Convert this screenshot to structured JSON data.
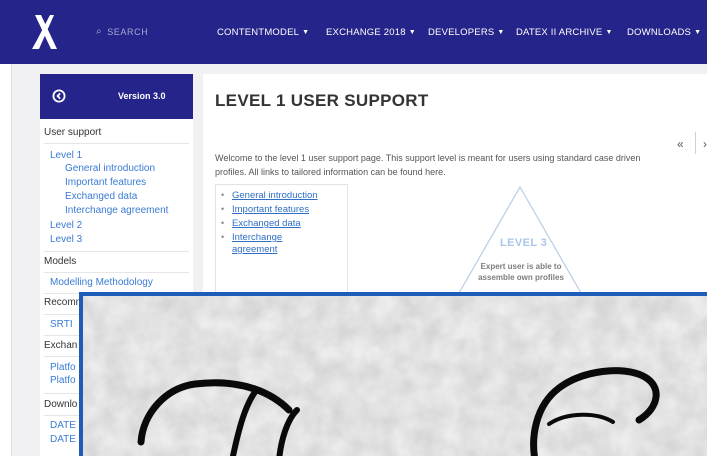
{
  "nav": {
    "logo_icon": "x-logo-icon",
    "search_label": "SEARCH",
    "items": [
      {
        "label": "CONTENTMODEL"
      },
      {
        "label": "EXCHANGE 2018"
      },
      {
        "label": "DEVELOPERS"
      },
      {
        "label": "DATEX II ARCHIVE"
      },
      {
        "label": "DOWNLOADS"
      }
    ],
    "brand_color": "#24248a"
  },
  "sidebar": {
    "version": "Version 3.0",
    "back_icon": "back-arrow-icon",
    "sections": [
      {
        "title": "User support",
        "items": [
          "Level 1",
          "General introduction",
          "Important features",
          "Exchanged data",
          "Interchange agreement",
          "Level 2",
          "Level 3"
        ]
      },
      {
        "title": "Models",
        "items": [
          "Modelling Methodology"
        ]
      },
      {
        "title": "Recomm",
        "items": [
          "SRTI"
        ]
      },
      {
        "title": "Exchan",
        "items": [
          "Platfo",
          "Platfo"
        ]
      },
      {
        "title": "Downlo",
        "items": [
          "DATE",
          "DATE"
        ]
      }
    ],
    "link_color": "#3a7bd5"
  },
  "main": {
    "title": "LEVEL 1 USER SUPPORT",
    "pager_prev": "«",
    "pager_next": "›",
    "intro_line1": "Welcome to the level 1 user support page. This support level is meant for users using standard case driven",
    "intro_line2": "profiles. All links to tailored information can be found here.",
    "toc": [
      "General introduction",
      "Important features",
      "Exchanged data",
      "Interchange",
      "agreement"
    ],
    "pyramid": {
      "label": "LEVEL 3",
      "desc_line1": "Expert user is able to",
      "desc_line2": "assemble own profiles"
    }
  },
  "overlay": {
    "border_color": "#1d5cb8"
  }
}
